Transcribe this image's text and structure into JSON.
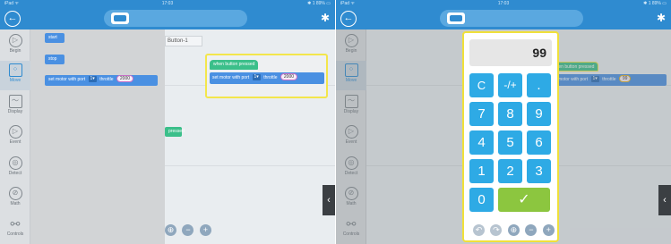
{
  "status_bar": {
    "carrier": "iPad ᯤ",
    "time": "17:03",
    "battery": "✱ 1 89% ▭"
  },
  "top_bar": {
    "back_icon": "back-arrow-icon",
    "device_icon": "robot-controller-icon",
    "bluetooth_icon": "bluetooth-icon"
  },
  "categories": [
    {
      "label": "Begin",
      "glyph": "▷"
    },
    {
      "label": "Move",
      "glyph": "⁘"
    },
    {
      "label": "Display",
      "glyph": "〜"
    },
    {
      "label": "Event",
      "glyph": "▷"
    },
    {
      "label": "Detect",
      "glyph": "◎"
    },
    {
      "label": "Math",
      "glyph": "⊘"
    },
    {
      "label": "Controls",
      "glyph": "⚯"
    }
  ],
  "active_category": "Move",
  "palette_blocks": {
    "start": "start",
    "stop": "stop",
    "motor_text": "set motor with port",
    "motor_port": "1▾",
    "motor_throttle": "throttle",
    "motor_value": "2000"
  },
  "workspace": {
    "tab_label": "Button-1",
    "hat_label": "when button pressed",
    "motor_text": "set motor with port",
    "motor_port": "1▾",
    "motor_throttle": "throttle",
    "motor_value": "2000",
    "pressed_label": "pressed",
    "handle_glyph": "‹"
  },
  "canvas_controls": [
    "⊕",
    "−",
    "+"
  ],
  "right_canvas_controls": [
    "↶",
    "↷",
    "⊕",
    "−",
    "+"
  ],
  "calculator": {
    "display_value": "99",
    "keys": {
      "c": "C",
      "neg": "-/+",
      "dot": ".",
      "k7": "7",
      "k8": "8",
      "k9": "9",
      "k4": "4",
      "k5": "5",
      "k6": "6",
      "k1": "1",
      "k2": "2",
      "k3": "3",
      "k0": "0",
      "ok": "✓"
    }
  },
  "right_workspace": {
    "hat_label": "when button pressed",
    "motor_text": "set motor with port",
    "motor_port": "1▾",
    "motor_throttle": "throttle",
    "motor_value": "99",
    "handle_glyph": "‹"
  },
  "colors": {
    "accent": "#2f8bd0",
    "highlight": "#f0e03a",
    "event_block": "#3bbf8a",
    "motor_block": "#4a90e2",
    "key_blue": "#2eaae5",
    "key_green": "#8cc63f"
  }
}
